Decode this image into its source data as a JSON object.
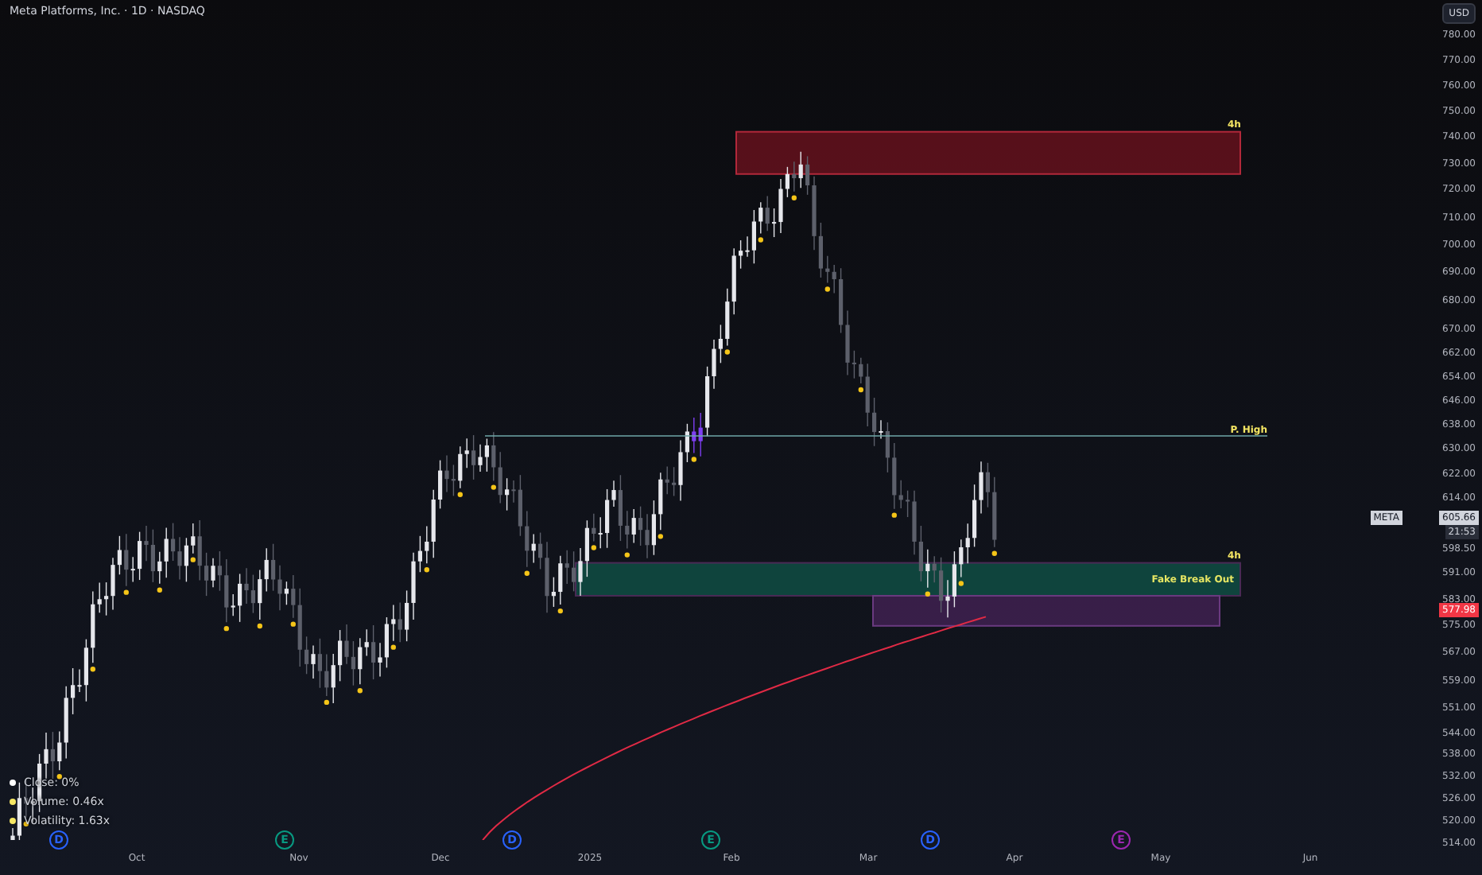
{
  "title": "Meta Platforms, Inc. · 1D · NASDAQ",
  "currency_button": "USD",
  "price_axis": {
    "ticks": [
      "780.00",
      "770.00",
      "760.00",
      "750.00",
      "740.00",
      "730.00",
      "720.00",
      "710.00",
      "700.00",
      "690.00",
      "680.00",
      "670.00",
      "662.00",
      "654.00",
      "646.00",
      "638.00",
      "630.00",
      "622.00",
      "614.00",
      "598.50",
      "591.00",
      "583.00",
      "575.00",
      "567.00",
      "559.00",
      "551.00",
      "544.00",
      "538.00",
      "532.00",
      "526.00",
      "520.00",
      "514.00"
    ]
  },
  "last_price_tag": {
    "symbol": "META",
    "price": "605.66",
    "countdown": "21:53"
  },
  "average_price_tag": {
    "price": "577.98"
  },
  "zones": [
    {
      "kind": "resistance",
      "label": "4h"
    },
    {
      "kind": "support",
      "label": "4h",
      "inner_label": "Fake Break Out"
    },
    {
      "kind": "imbalance"
    }
  ],
  "level_line": {
    "label": "P. High"
  },
  "legend": [
    {
      "text": "Close: 0%",
      "color": "#ffffff"
    },
    {
      "text": "Volume: 0.46x",
      "color": "#f5e663"
    },
    {
      "text": "Volatility: 1.63x",
      "color": "#f5e663"
    }
  ],
  "events": [
    {
      "letter": "D",
      "color": "#2962ff"
    },
    {
      "letter": "E",
      "color": "#089981"
    },
    {
      "letter": "D",
      "color": "#2962ff"
    },
    {
      "letter": "E",
      "color": "#089981"
    },
    {
      "letter": "D",
      "color": "#2962ff"
    },
    {
      "letter": "E",
      "color": "#9c27b0"
    }
  ],
  "time_axis": [
    "Oct",
    "Nov",
    "Dec",
    "2025",
    "Feb",
    "Mar",
    "Apr",
    "May",
    "Jun"
  ]
}
